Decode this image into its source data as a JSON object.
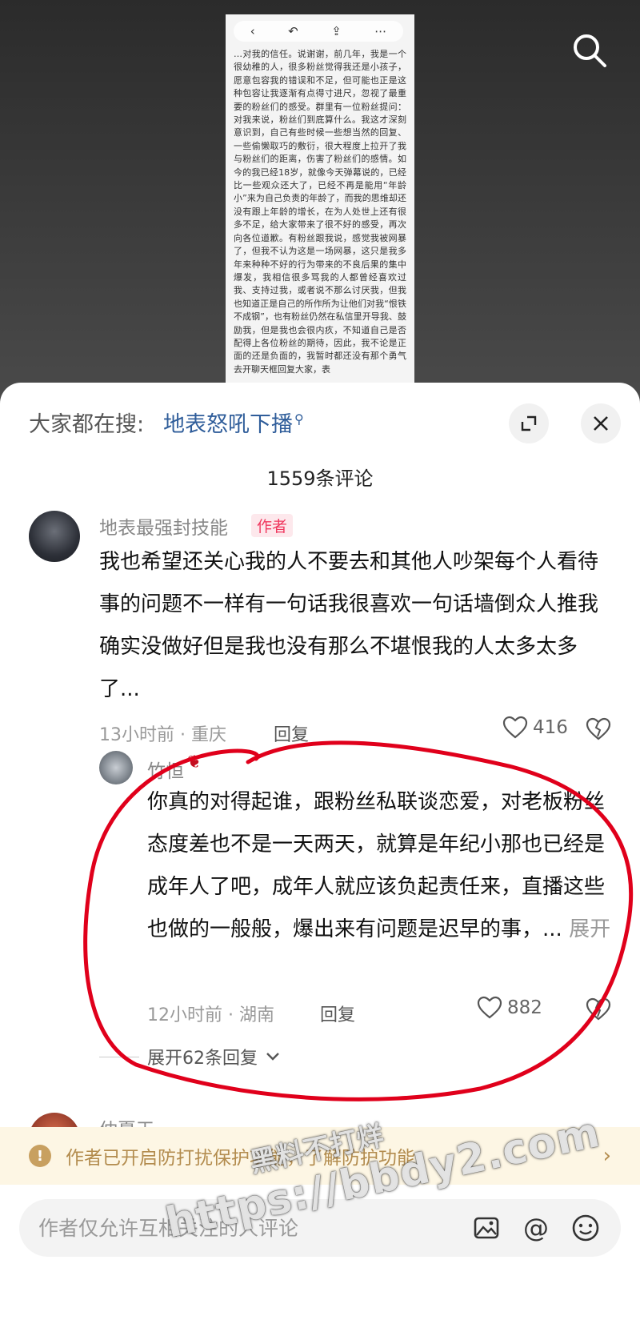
{
  "document_screenshot": {
    "text": "…对我的信任。说谢谢，前几年，我是一个很幼稚的人，很多粉丝觉得我还是小孩子，愿意包容我的错误和不足，但可能也正是这种包容让我逐渐有点得寸进尺，忽视了最重要的粉丝们的感受。群里有一位粉丝提问：对我来说，粉丝们到底算什么。我这才深刻意识到，自己有些时候一些想当然的回复、一些偷懒取巧的敷衍，很大程度上拉开了我与粉丝们的距离，伤害了粉丝们的感情。如今的我已经18岁，就像今天弹幕说的，已经比一些观众还大了，已经不再是能用“年龄小”来为自己负责的年龄了，而我的思维却还没有跟上年龄的增长，在为人处世上还有很多不足，给大家带来了很不好的感受，再次向各位道歉。有粉丝跟我说，感觉我被网暴了，但我不认为这是一场网暴，这只是我多年来种种不好的行为带来的不良后果的集中爆发，我相信很多骂我的人都曾经喜欢过我、支持过我，或者说不那么讨厌我，但我也知道正是自己的所作所为让他们对我“恨铁不成钢”，也有粉丝仍然在私信里开导我、鼓励我，但是我也会很内疚，不知道自己是否配得上各位粉丝的期待，因此，我不论是正面的还是负面的，我暂时都还没有那个勇气去开聊天框回复大家，表"
  },
  "header": {
    "trend_label": "大家都在搜:",
    "trend_link": "地表怒吼下播",
    "comment_count": "1559条评论"
  },
  "comments": [
    {
      "username": "地表最强封技能",
      "badge": "作者",
      "text": "我也希望还关心我的人不要去和其他人吵架每个人看待事的问题不一样有一句话我很喜欢一句话墙倒众人推我确实没做好但是我也没有那么不堪恨我的人太多太多了...",
      "meta": "13小时前 · 重庆",
      "reply_label": "回复",
      "likes": "416"
    }
  ],
  "reply": {
    "username": "竹恒",
    "text": "你真的对得起谁，跟粉丝私联谈恋爱，对老板粉丝态度差也不是一天两天，就算是年纪小那也已经是成年人了吧，成年人就应该负起责任来，直播这些也做的一般般，爆出来有问题是迟早的事，...",
    "expand_label": "展开",
    "meta": "12小时前 · 湖南",
    "reply_label": "回复",
    "likes": "882"
  },
  "expand_replies": "展开62条回复",
  "next_comment_username": "仲夏天",
  "notice": {
    "text": "作者已开启防打扰保护功能，了解防护功能"
  },
  "input": {
    "placeholder": "作者仅允许互相关注的人评论"
  },
  "watermark": {
    "title": "黑料不打烊",
    "url": "https://bbdy2.com"
  },
  "colors": {
    "link_blue": "#2f5d9a",
    "author_badge": "#f0375e",
    "annotation_red": "#e0001b",
    "notice_text": "#b38c4e"
  },
  "icons": [
    "search-icon",
    "expand-icon",
    "close-icon",
    "heart-icon",
    "broken-heart-icon",
    "chevron-down-icon",
    "warning-icon",
    "chevron-right-icon",
    "image-icon",
    "at-icon",
    "emoji-icon"
  ]
}
